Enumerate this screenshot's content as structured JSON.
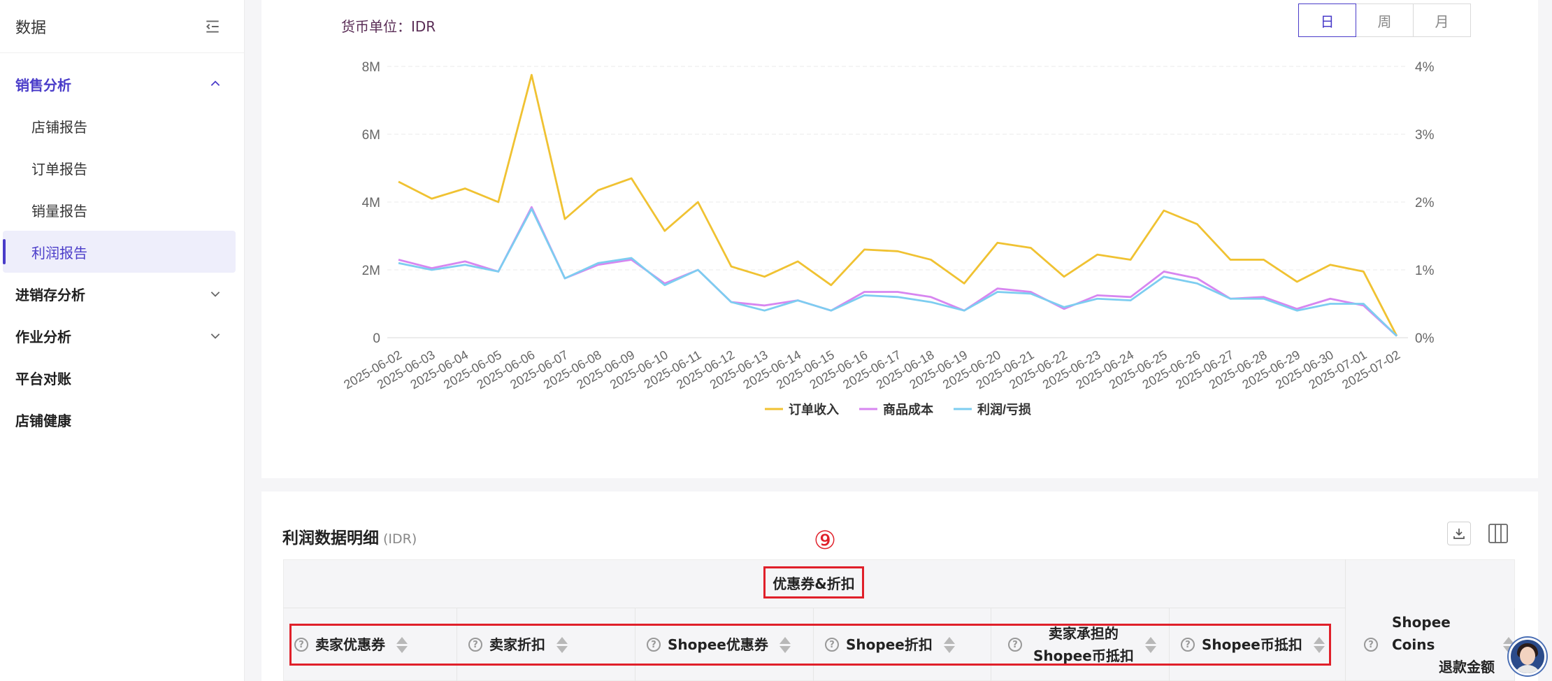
{
  "sidebar": {
    "title": "数据",
    "groups": [
      {
        "label": "销售分析",
        "expanded": true,
        "items": [
          "店铺报告",
          "订单报告",
          "销量报告",
          "利润报告"
        ],
        "active_item": "利润报告"
      },
      {
        "label": "进销存分析",
        "expanded": false
      },
      {
        "label": "作业分析",
        "expanded": false
      },
      {
        "label": "平台对账"
      },
      {
        "label": "店铺健康"
      }
    ]
  },
  "chart_panel": {
    "currency_label": "货币单位：IDR",
    "period_tabs": [
      "日",
      "周",
      "月"
    ],
    "active_tab": "日"
  },
  "chart_data": {
    "type": "line",
    "categories": [
      "2025-06-02",
      "2025-06-03",
      "2025-06-04",
      "2025-06-05",
      "2025-06-06",
      "2025-06-07",
      "2025-06-08",
      "2025-06-09",
      "2025-06-10",
      "2025-06-11",
      "2025-06-12",
      "2025-06-13",
      "2025-06-14",
      "2025-06-15",
      "2025-06-16",
      "2025-06-17",
      "2025-06-18",
      "2025-06-19",
      "2025-06-20",
      "2025-06-21",
      "2025-06-22",
      "2025-06-23",
      "2025-06-24",
      "2025-06-25",
      "2025-06-26",
      "2025-06-27",
      "2025-06-28",
      "2025-06-29",
      "2025-06-30",
      "2025-07-01",
      "2025-07-02"
    ],
    "series": [
      {
        "name": "订单收入",
        "color": "#f0c232",
        "values": [
          4.6,
          4.1,
          4.4,
          4.0,
          7.75,
          3.5,
          4.35,
          4.7,
          3.15,
          4.0,
          2.1,
          1.8,
          2.25,
          1.55,
          2.6,
          2.55,
          2.3,
          1.6,
          2.8,
          2.65,
          1.8,
          2.45,
          2.3,
          3.75,
          3.35,
          2.3,
          2.3,
          1.65,
          2.15,
          1.95,
          0.05
        ]
      },
      {
        "name": "商品成本",
        "color": "#d786f0",
        "values": [
          2.3,
          2.05,
          2.25,
          1.95,
          3.85,
          1.75,
          2.15,
          2.3,
          1.6,
          2.0,
          1.05,
          0.95,
          1.1,
          0.8,
          1.35,
          1.35,
          1.2,
          0.8,
          1.45,
          1.35,
          0.85,
          1.25,
          1.2,
          1.95,
          1.75,
          1.15,
          1.2,
          0.85,
          1.15,
          0.95,
          0.05
        ]
      },
      {
        "name": "利润/亏损",
        "color": "#7dcdf0",
        "values": [
          2.2,
          2.0,
          2.15,
          1.95,
          3.8,
          1.75,
          2.2,
          2.35,
          1.55,
          2.0,
          1.05,
          0.8,
          1.1,
          0.8,
          1.25,
          1.2,
          1.05,
          0.8,
          1.35,
          1.3,
          0.9,
          1.15,
          1.1,
          1.8,
          1.6,
          1.15,
          1.15,
          0.8,
          1.0,
          1.0,
          0.05
        ]
      }
    ],
    "y_left": {
      "ticks": [
        "0",
        "2M",
        "4M",
        "6M",
        "8M"
      ],
      "ylim": [
        0,
        8
      ]
    },
    "y_right": {
      "ticks": [
        "0%",
        "1%",
        "2%",
        "3%",
        "4%"
      ]
    },
    "grid": true,
    "legend_position": "bottom-center"
  },
  "table": {
    "title": "利润数据明细",
    "unit": "(IDR)",
    "marker": "⑨",
    "group_header": "优惠券&折扣",
    "columns": [
      {
        "line1": "卖家优惠券",
        "line2": ""
      },
      {
        "line1": "卖家折扣",
        "line2": ""
      },
      {
        "line1": "Shopee优惠券",
        "line2": ""
      },
      {
        "line1": "Shopee折扣",
        "line2": ""
      },
      {
        "line1": "卖家承担的",
        "line2": "Shopee币抵扣"
      },
      {
        "line1": "Shopee币抵扣",
        "line2": ""
      },
      {
        "line1": "Shopee Coins",
        "line2": "退款金额"
      }
    ]
  },
  "colors": {
    "accent": "#4a3cc9",
    "highlight": "#e0202a"
  }
}
